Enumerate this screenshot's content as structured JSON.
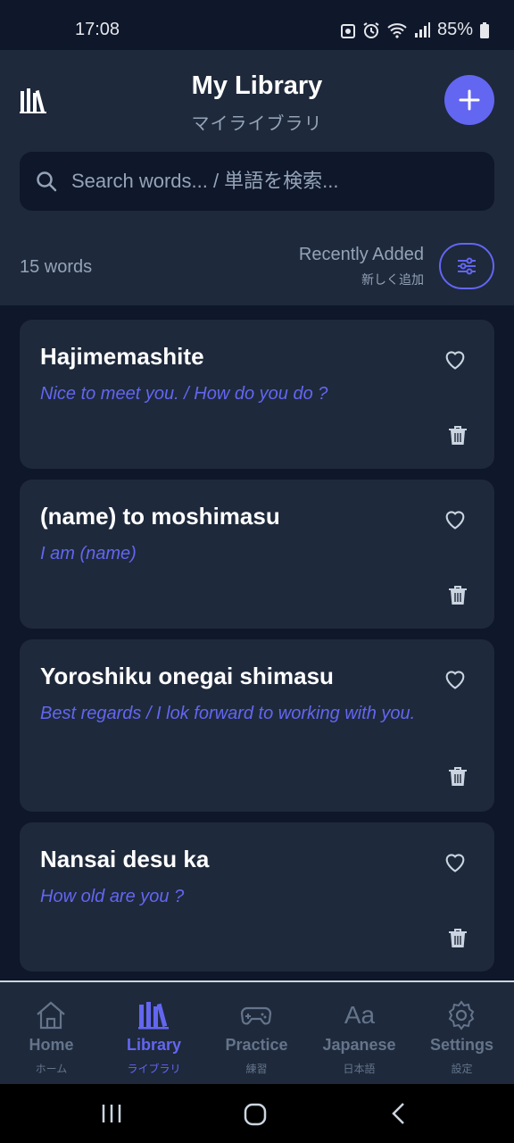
{
  "status_bar": {
    "time": "17:08",
    "battery": "85%"
  },
  "header": {
    "title": "My Library",
    "subtitle": "マイライブラリ",
    "search_placeholder": "Search words... / 単語を検索...",
    "word_count": "15 words",
    "sort_label": "Recently Added",
    "sort_sublabel": "新しく追加",
    "accent_color": "#6366f1"
  },
  "words": [
    {
      "term": "Hajimemashite",
      "meaning": "Nice to meet you. / How do you do ?"
    },
    {
      "term": "(name) to moshimasu",
      "meaning": "I am (name)"
    },
    {
      "term": "Yoroshiku onegai shimasu",
      "meaning": "Best regards / I lok forward to working with you."
    },
    {
      "term": "Nansai desu ka",
      "meaning": "How old are you ?"
    }
  ],
  "nav": {
    "items": [
      {
        "label": "Home",
        "sublabel": "ホーム",
        "icon": "home-icon"
      },
      {
        "label": "Library",
        "sublabel": "ライブラリ",
        "icon": "library-icon",
        "active": true
      },
      {
        "label": "Practice",
        "sublabel": "練習",
        "icon": "gamepad-icon"
      },
      {
        "label": "Japanese",
        "sublabel": "日本語",
        "icon": "font-icon",
        "icon_text": "Aa"
      },
      {
        "label": "Settings",
        "sublabel": "設定",
        "icon": "gear-icon"
      }
    ]
  }
}
